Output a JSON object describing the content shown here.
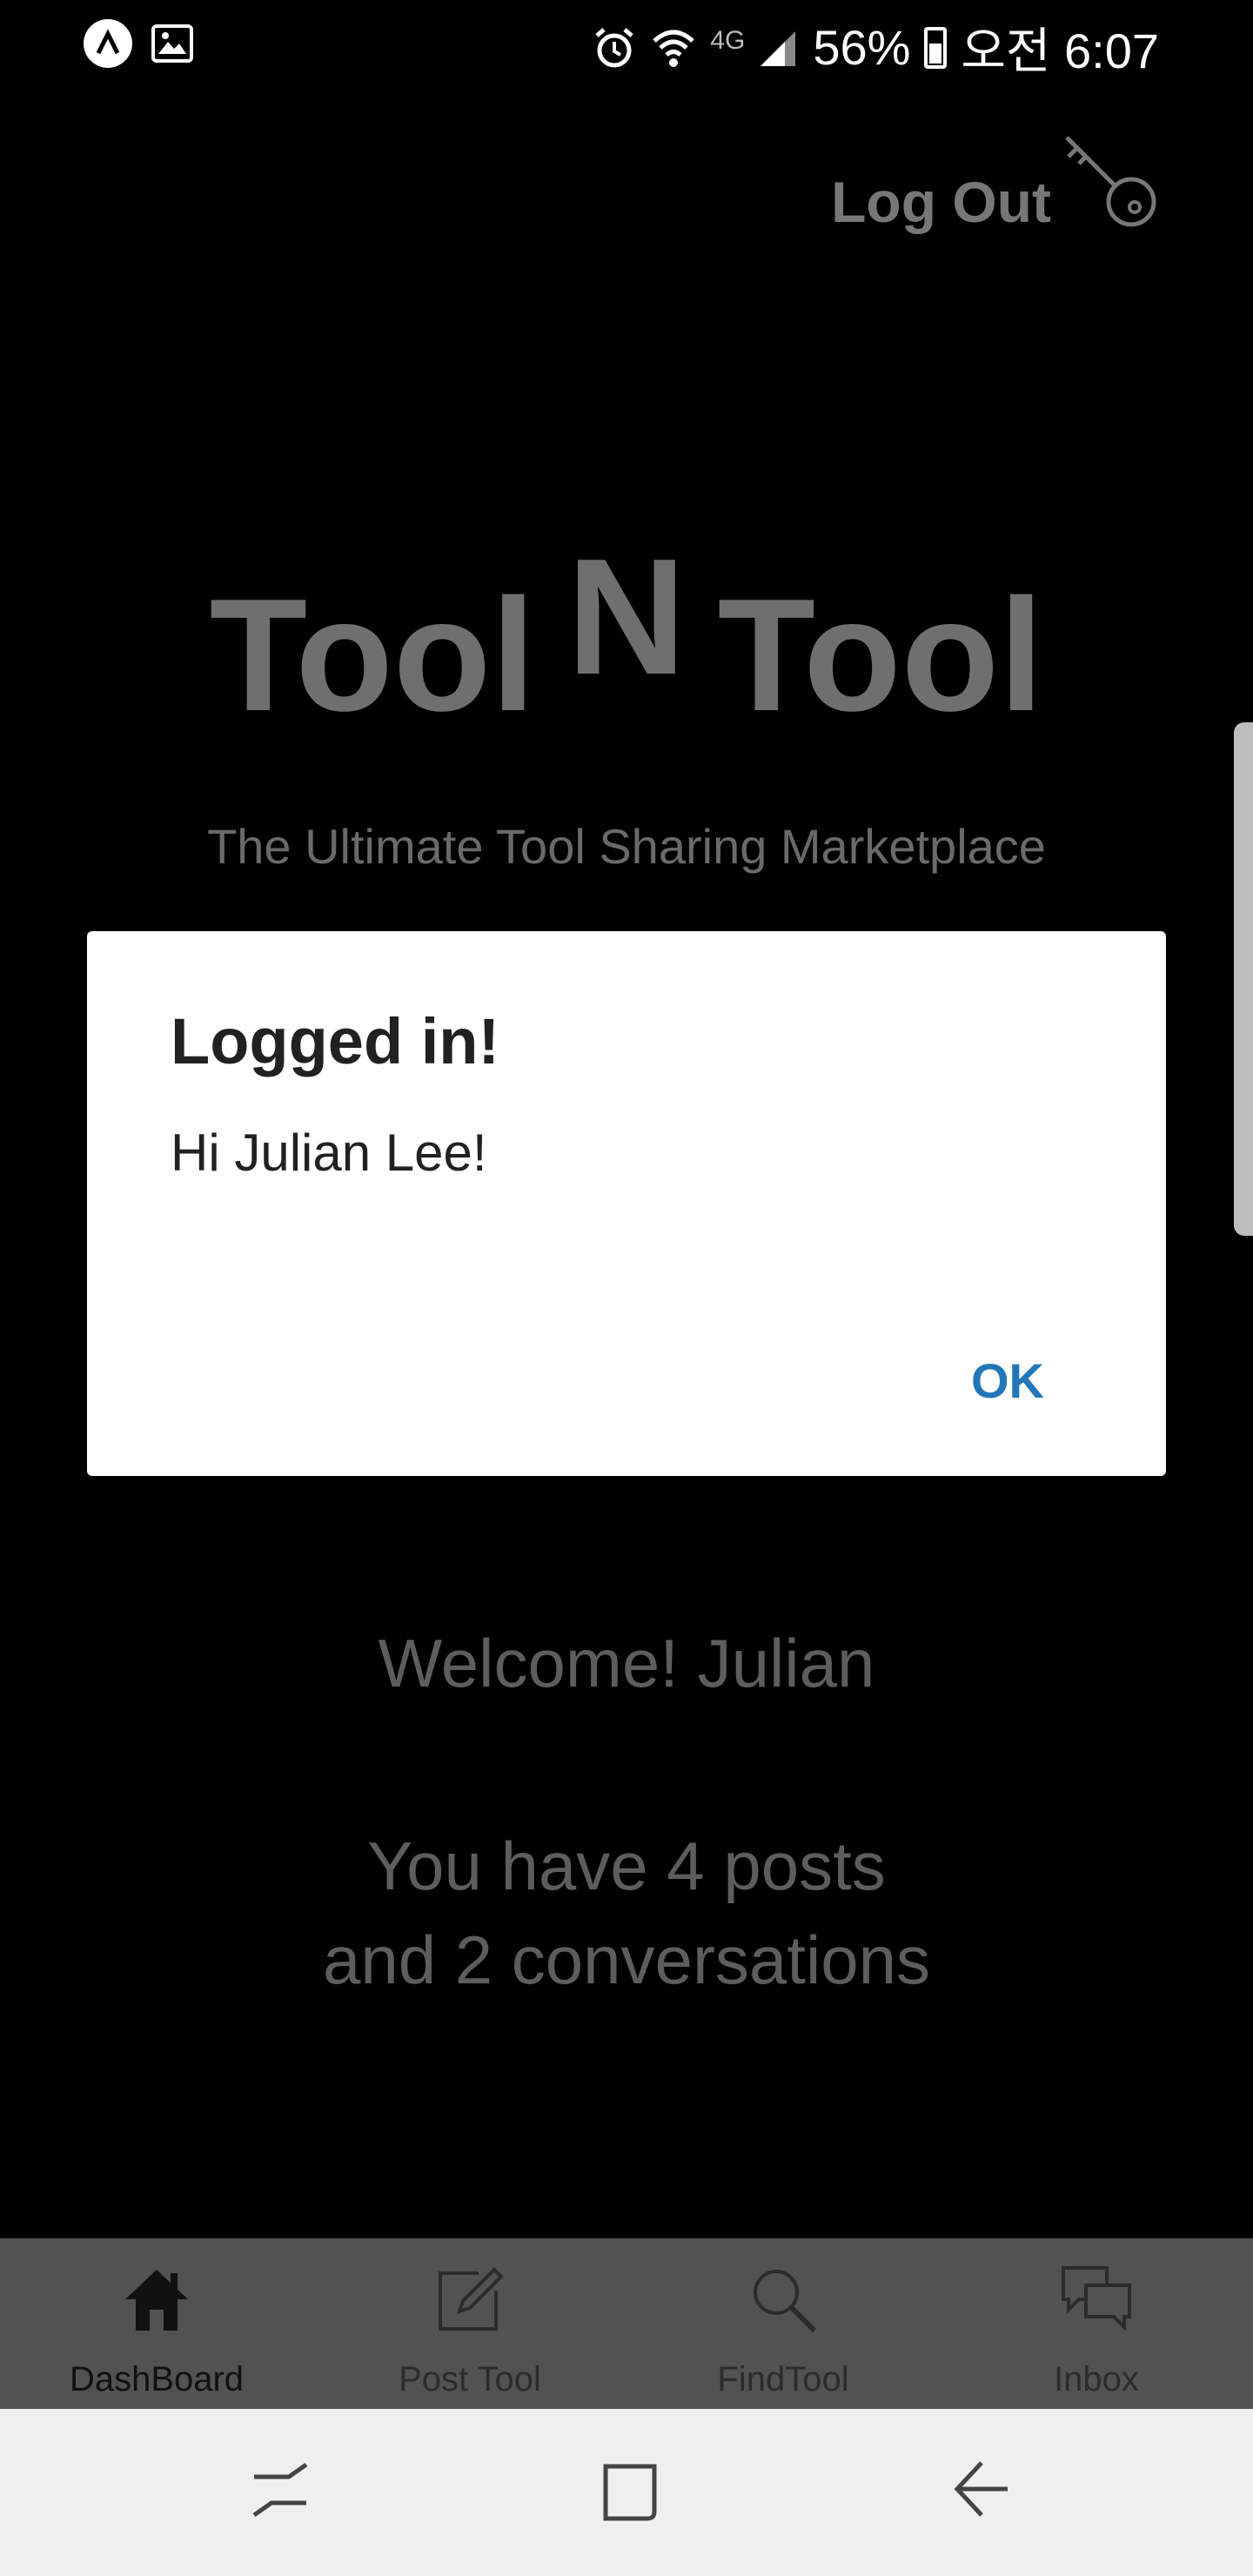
{
  "status_bar": {
    "battery": "56%",
    "clock": "오전 6:07",
    "network": "4G",
    "icons": [
      "app-a-icon",
      "gallery-icon",
      "alarm-icon",
      "wifi-icon",
      "signal-icon",
      "battery-icon"
    ]
  },
  "header": {
    "logout_label": "Log Out",
    "logout_icon": "key-icon"
  },
  "hero": {
    "title_left": "Tool",
    "title_mid": "N",
    "title_right": "Tool",
    "subtitle": "The Ultimate Tool Sharing Marketplace"
  },
  "main": {
    "welcome": "Welcome! Julian",
    "stats_line1": "You have 4 posts",
    "stats_line2": "and 2 conversations"
  },
  "tabs": [
    {
      "label": "DashBoard",
      "icon": "home-icon"
    },
    {
      "label": "Post Tool",
      "icon": "edit-icon"
    },
    {
      "label": "FindTool",
      "icon": "search-icon"
    },
    {
      "label": "Inbox",
      "icon": "chat-icon"
    }
  ],
  "dialog": {
    "title": "Logged in!",
    "message": "Hi Julian Lee!",
    "ok_label": "OK"
  },
  "colors": {
    "accent": "#2377b8",
    "overlay": "#000000",
    "tabbar": "#525252"
  }
}
